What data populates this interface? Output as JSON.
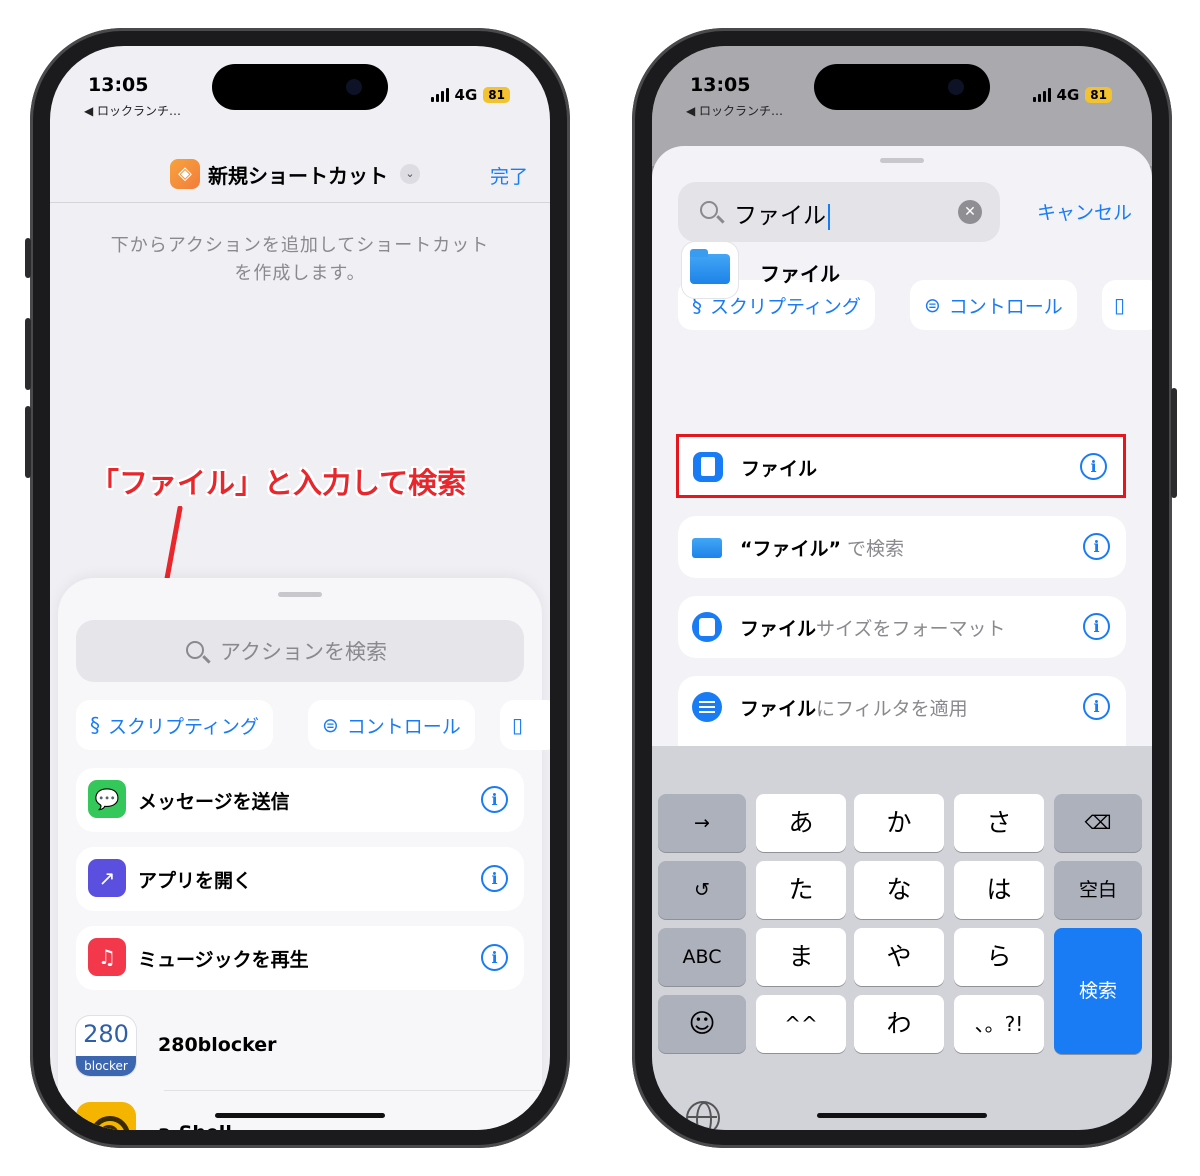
{
  "status": {
    "time": "13:05",
    "back_label": "◀ ロックランチ…",
    "network": "4G",
    "battery": "81"
  },
  "left": {
    "nav": {
      "title": "新規ショートカット",
      "done": "完了"
    },
    "hint": "下からアクションを追加してショートカットを作成します。",
    "annotation": "「ファイル」と入力して検索",
    "search": {
      "placeholder": "アクションを検索"
    },
    "chips": [
      {
        "icon": "script-icon",
        "label": "スクリプティング"
      },
      {
        "icon": "toggle-icon",
        "label": "コントロール"
      }
    ],
    "actions": [
      {
        "icon": "message-icon",
        "label": "メッセージを送信",
        "color": "#34c759"
      },
      {
        "icon": "open-app-icon",
        "label": "アプリを開く",
        "color": "#5b4fe0"
      },
      {
        "icon": "music-icon",
        "label": "ミュージックを再生",
        "color": "#f2384a"
      }
    ],
    "apps": [
      {
        "name": "280blocker",
        "icon_text": "280",
        "icon_tag": "blocker"
      },
      {
        "name": "a-Shell"
      }
    ]
  },
  "right": {
    "search": {
      "value": "ファイル",
      "cancel": "キャンセル"
    },
    "chips": [
      {
        "icon": "script-icon",
        "label": "スクリプティング"
      },
      {
        "icon": "toggle-icon",
        "label": "コントロール"
      }
    ],
    "app_section": {
      "name": "ファイル"
    },
    "results": [
      {
        "icon": "document-icon",
        "bold": "ファイル",
        "rest": "",
        "highlighted": true
      },
      {
        "icon": "folder-icon",
        "bold": "“ファイル”",
        "rest": " で検索",
        "highlighted": false
      },
      {
        "icon": "file-size-icon",
        "bold": "ファイル",
        "rest": "サイズをフォーマット",
        "highlighted": false
      },
      {
        "icon": "filter-icon",
        "bold": "ファイル",
        "rest": "にフィルタを適用",
        "highlighted": false
      }
    ],
    "keyboard": {
      "row1": [
        "→",
        "あ",
        "か",
        "さ",
        "⌫"
      ],
      "row2": [
        "↺",
        "た",
        "な",
        "は",
        "空白"
      ],
      "row3": [
        "ABC",
        "ま",
        "や",
        "ら"
      ],
      "row4": [
        "☺",
        "^^",
        "わ",
        "、。?!"
      ],
      "search_key": "検索"
    }
  },
  "colors": {
    "accent": "#1a7cf5",
    "annotation": "#e8262c",
    "highlight_border": "#e5161d"
  }
}
